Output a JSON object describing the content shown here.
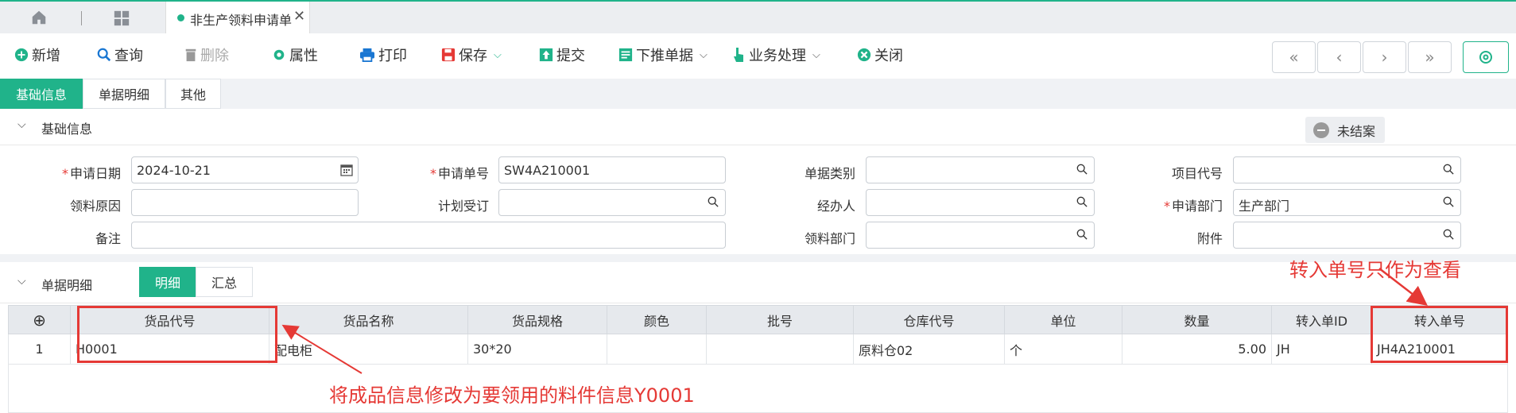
{
  "window": {
    "tab_title": "非生产领料申请单",
    "tab_close": "✕",
    "accent": "#20b38a"
  },
  "toolbar": {
    "add": "新增",
    "query": "查询",
    "delete": "删除",
    "properties": "属性",
    "print": "打印",
    "save": "保存",
    "submit": "提交",
    "push_down": "下推单据",
    "business": "业务处理",
    "close": "关闭"
  },
  "page_tabs": [
    "基础信息",
    "单据明细",
    "其他"
  ],
  "basic": {
    "section_title": "基础信息",
    "status_badge": "未结案",
    "labels": {
      "apply_date": "申请日期",
      "apply_no": "申请单号",
      "doc_type": "单据类别",
      "project_code": "项目代号",
      "reason": "领料原因",
      "plan_order": "计划受订",
      "handler": "经办人",
      "apply_dept": "申请部门",
      "remark": "备注",
      "pick_dept": "领料部门",
      "attachment": "附件"
    },
    "values": {
      "apply_date": "2024-10-21",
      "apply_no": "SW4A210001",
      "apply_dept": "生产部门"
    }
  },
  "detail": {
    "section_title": "单据明细",
    "sub_tabs": [
      "明细",
      "汇总"
    ],
    "add_row_icon": "⊕",
    "columns": [
      "货品代号",
      "货品名称",
      "货品规格",
      "颜色",
      "批号",
      "仓库代号",
      "单位",
      "数量",
      "转入单ID",
      "转入单号"
    ],
    "rows": [
      {
        "no": "1",
        "code": "H0001",
        "name": "配电柜",
        "spec": "30*20",
        "color": "",
        "batch": "",
        "warehouse": "原料仓02",
        "unit": "个",
        "qty": "5.00",
        "src_id": "JH",
        "src_no": "JH4A210001"
      }
    ]
  },
  "annotations": {
    "left": "将成品信息修改为要领用的料件信息Y0001",
    "right": "转入单号只作为查看",
    "color": "#e53935"
  }
}
